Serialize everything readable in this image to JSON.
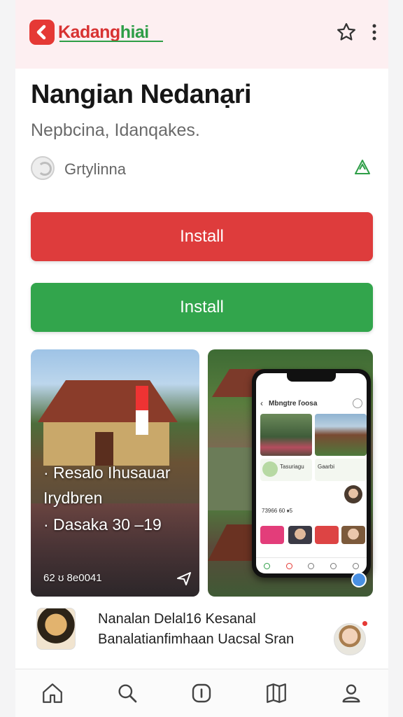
{
  "header": {
    "brand_part1": "Kadang",
    "brand_part2": "hiai",
    "star_icon": "star-icon",
    "more_icon": "more-vertical-icon"
  },
  "app": {
    "title": "Nangian Nedanạri",
    "subtitle": "Nepbcina, Idanqakes.",
    "developer": "Grtylinna"
  },
  "buttons": {
    "install_primary": "Install",
    "install_secondary": "Install"
  },
  "screenshots": {
    "shot1": {
      "line1": "· Resalo Ihusauar",
      "line2": "Irydbren",
      "line3": "· Dasaka 30 –19",
      "caption": "62 ʊ 8e0041"
    },
    "shot2": {
      "phone_title": "Mbngtre ľoosa",
      "row1": "Tasuriagu",
      "row2": "Gaarbi",
      "counter": "73966 60 ♦5"
    }
  },
  "info": {
    "text": "Nanalan Delal16 Kesanal Banalatianfimhaan Uacsal Sran"
  },
  "colors": {
    "install_red": "#de3c3c",
    "install_green": "#32a54c",
    "brand_red": "#e53935"
  },
  "bottom_nav": [
    "home-icon",
    "search-icon",
    "info-icon",
    "bookmark-icon",
    "profile-icon"
  ]
}
